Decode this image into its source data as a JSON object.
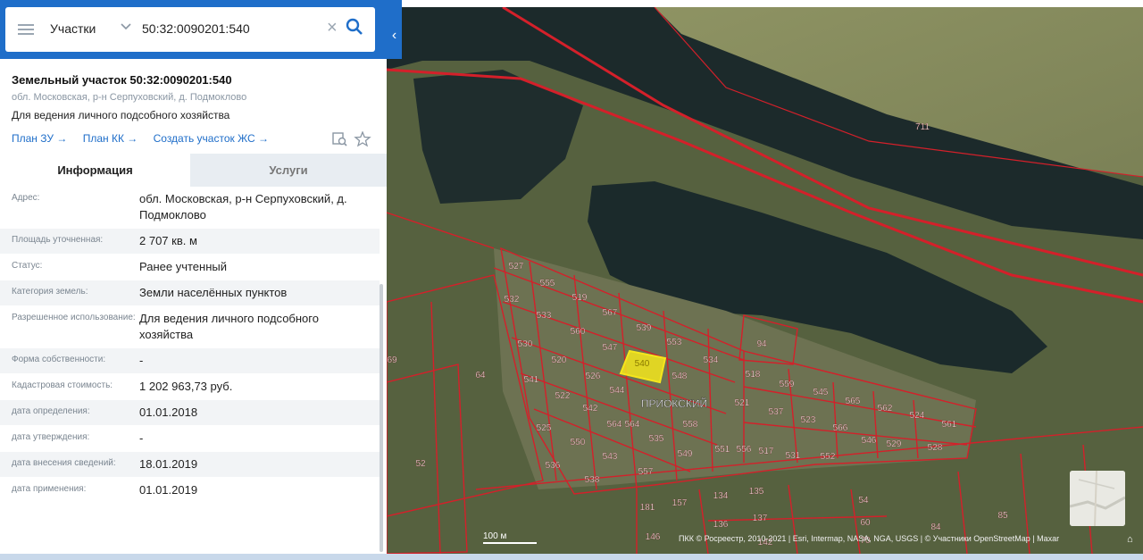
{
  "search": {
    "type_label": "Участки",
    "value": "50:32:0090201:540"
  },
  "parcel": {
    "title": "Земельный участок 50:32:0090201:540",
    "address": "обл. Московская, р-н Серпуховский, д. Подмоклово",
    "use": "Для ведения личного подсобного хозяйства"
  },
  "links": {
    "plan_zu": "План ЗУ →",
    "plan_kk": "План КК →",
    "create": "Создать участок ЖС →"
  },
  "tabs": {
    "info": "Информация",
    "services": "Услуги"
  },
  "info_rows": [
    {
      "label": "Адрес:",
      "value": "обл. Московская, р-н Серпуховский, д. Подмоклово"
    },
    {
      "label": "Площадь уточненная:",
      "value": "2 707 кв. м"
    },
    {
      "label": "Статус:",
      "value": "Ранее учтенный"
    },
    {
      "label": "Категория земель:",
      "value": "Земли населённых пунктов"
    },
    {
      "label": "Разрешенное использование:",
      "value": "Для ведения личного подсобного хозяйства"
    },
    {
      "label": "Форма собственности:",
      "value": "-"
    },
    {
      "label": "Кадастровая стоимость:",
      "value": "1 202 963,73 руб."
    },
    {
      "label": "дата определения:",
      "value": "01.01.2018"
    },
    {
      "label": "дата утверждения:",
      "value": "-"
    },
    {
      "label": "дата внесения сведений:",
      "value": "18.01.2019"
    },
    {
      "label": "дата применения:",
      "value": "01.01.2019"
    }
  ],
  "map": {
    "place_label": "ПРИОКСКИЙ",
    "scale": "100 м",
    "attribution": "ПКК © Росреестр, 2010-2021 | Esri, Intermap, NASA, NGA, USGS | © Участники OpenStreetMap | Maxar",
    "parcel_numbers": [
      "711",
      "527",
      "555",
      "519",
      "567",
      "539",
      "553",
      "532",
      "533",
      "560",
      "547",
      "540",
      "534",
      "530",
      "520",
      "526",
      "544",
      "548",
      "542",
      "518",
      "559",
      "545",
      "565",
      "562",
      "524",
      "561",
      "94",
      "64",
      "69",
      "52",
      "541",
      "522",
      "564",
      "564",
      "558",
      "521",
      "537",
      "523",
      "566",
      "546",
      "529",
      "528",
      "525",
      "550",
      "543",
      "535",
      "549",
      "551",
      "556",
      "517",
      "531",
      "552",
      "536",
      "538",
      "557",
      "181",
      "157",
      "134",
      "135",
      "136",
      "137",
      "84",
      "85",
      "54",
      "60",
      "70",
      "142",
      "146"
    ],
    "colors": {
      "parcel_outline": "#d4202a",
      "selected_fill": "#f5e61c",
      "water": "#1c2a2b"
    }
  }
}
